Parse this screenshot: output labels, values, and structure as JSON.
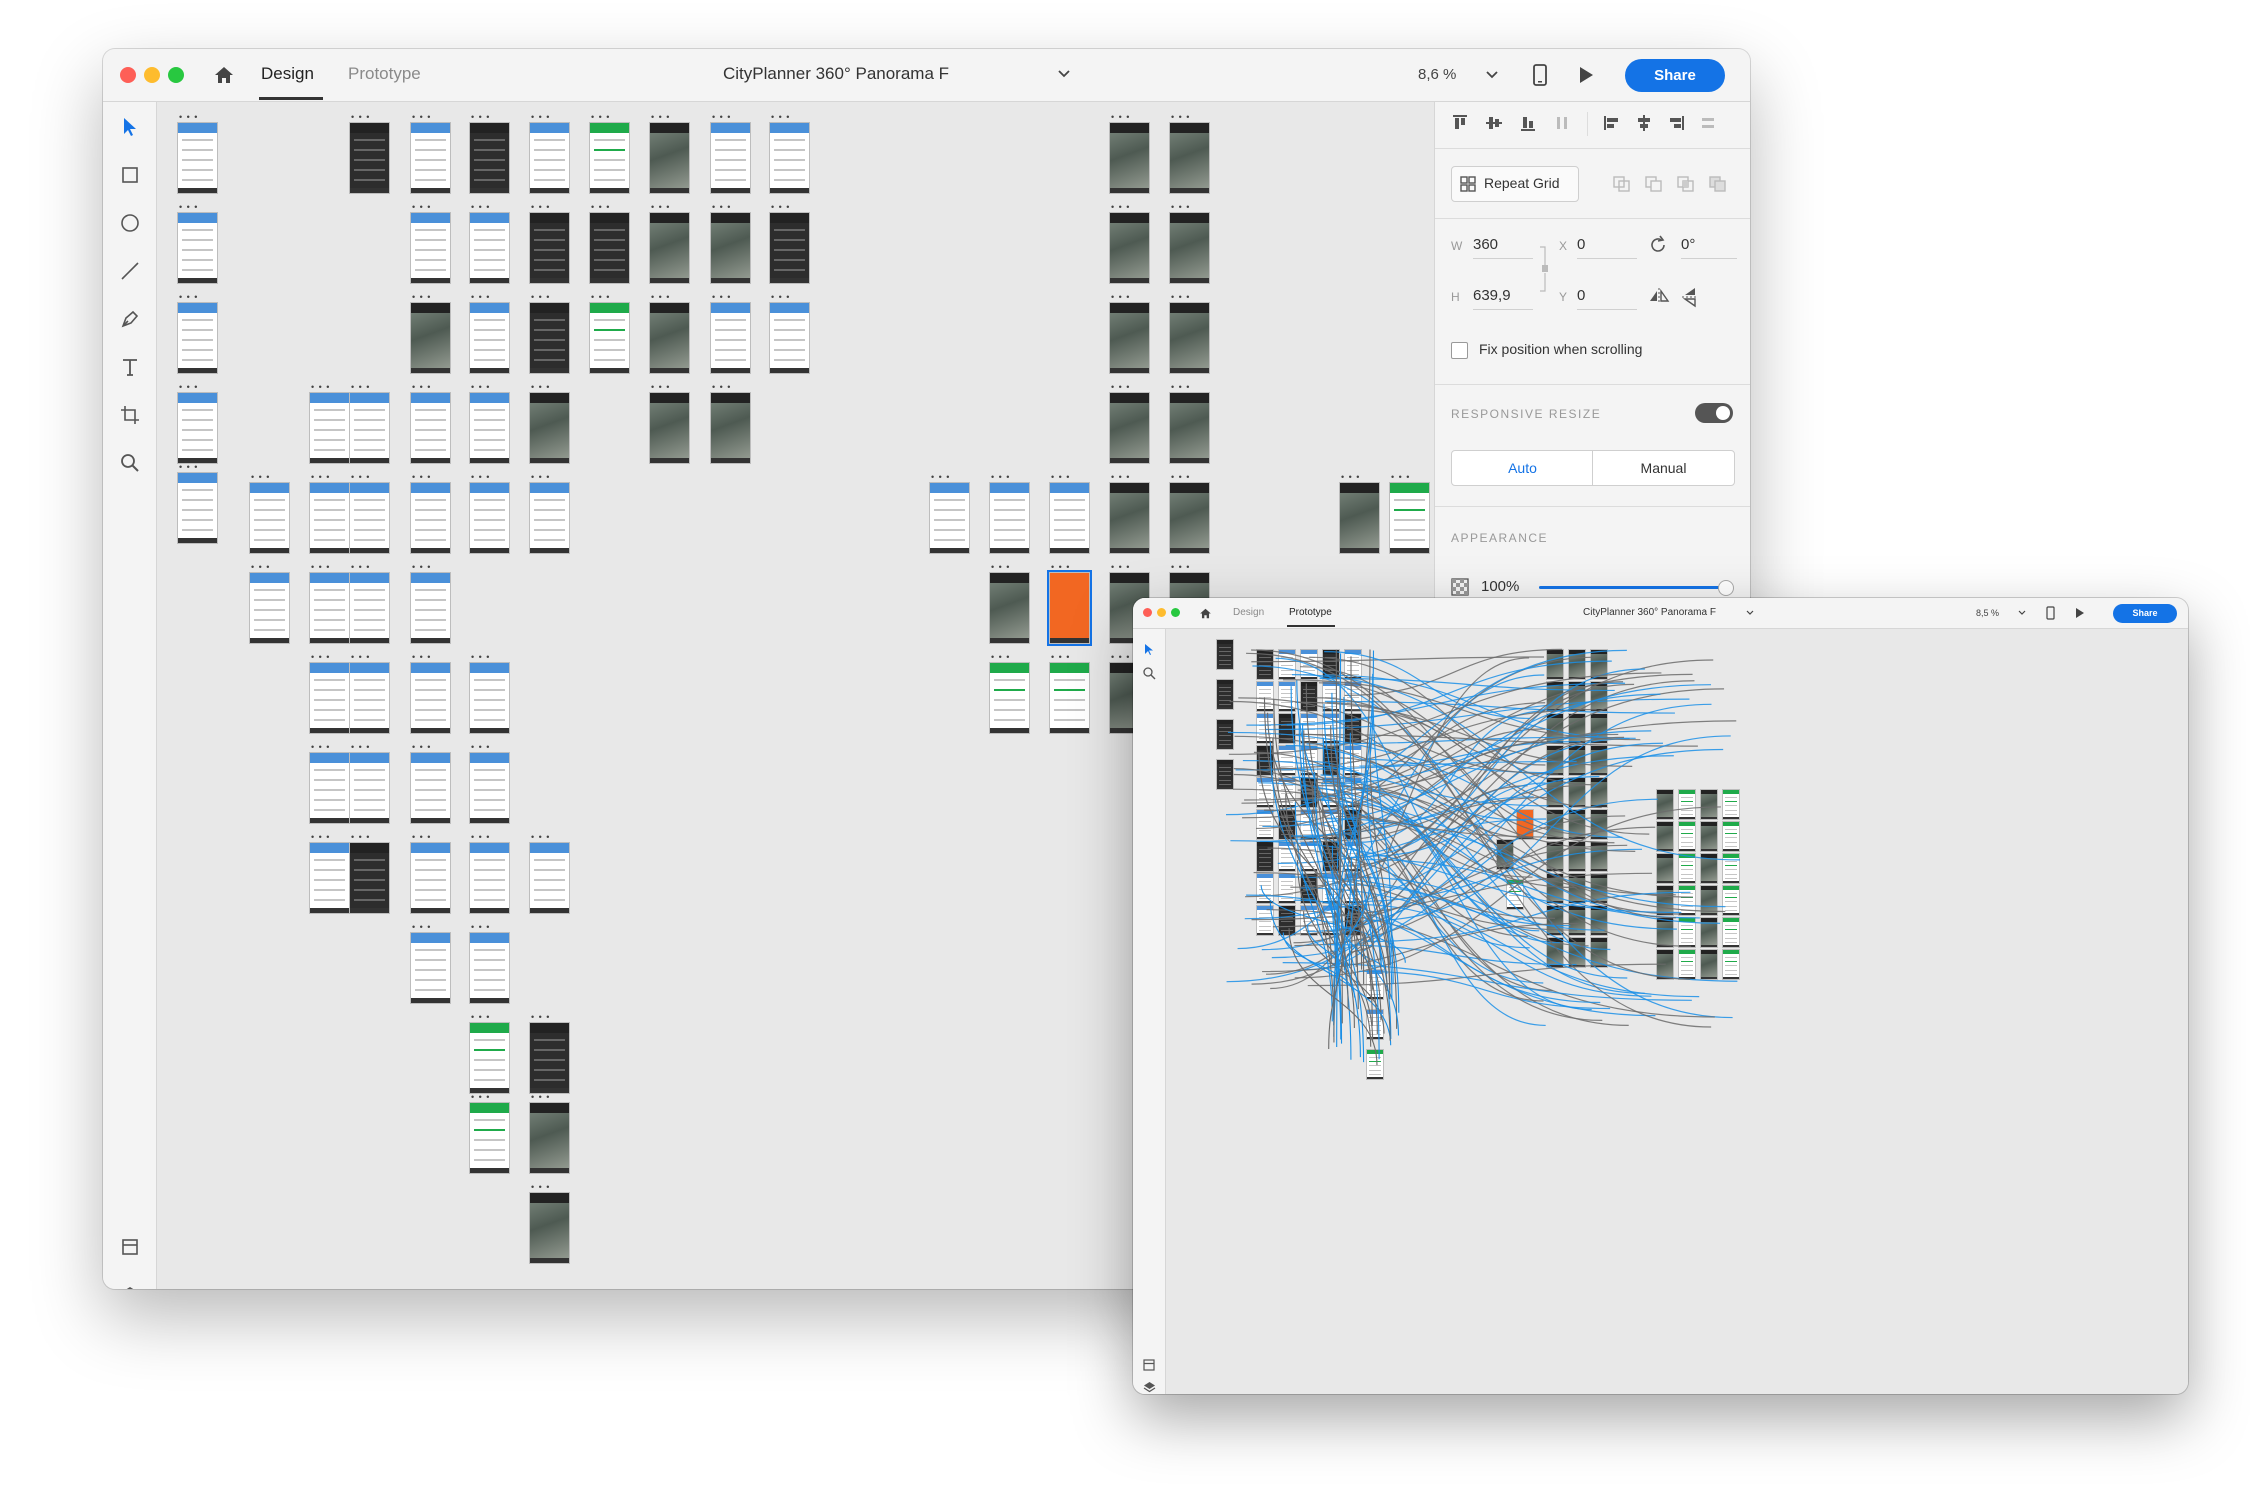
{
  "main": {
    "tabs": [
      {
        "label": "Design"
      },
      {
        "label": "Prototype"
      }
    ],
    "title": "CityPlanner 360° Panorama F",
    "zoom": "8,6 %",
    "share": "Share",
    "tools": [
      "select-icon",
      "rectangle-icon",
      "ellipse-icon",
      "line-icon",
      "pen-icon",
      "text-icon",
      "artboard-icon",
      "zoom-icon"
    ],
    "bottom_tools": [
      "assets-icon",
      "layers-icon"
    ],
    "inspector": {
      "repeat_grid": "Repeat Grid",
      "w_label": "W",
      "w": "360",
      "x_label": "X",
      "x": "0",
      "rotation": "0°",
      "h_label": "H",
      "h": "639,9",
      "y_label": "Y",
      "y": "0",
      "fix_position": "Fix position when scrolling",
      "fix_position_checked": false,
      "responsive_label": "RESPONSIVE RESIZE",
      "responsive_on": true,
      "resize_options": [
        "Auto",
        "Manual"
      ],
      "resize_selected": "Auto",
      "appearance_label": "APPEARANCE",
      "opacity": "100%",
      "opacity_value": 1.0
    }
  },
  "proto": {
    "tabs": [
      {
        "label": "Design"
      },
      {
        "label": "Prototype"
      }
    ],
    "active_tab": "Prototype",
    "title": "CityPlanner 360° Panorama F",
    "zoom": "8,5 %",
    "share": "Share"
  },
  "colors": {
    "accent": "#1473e6",
    "wire_blue": "#1b8fe6",
    "wire_gray": "#6b6b6b",
    "header_blue": "#4a90d9",
    "header_green": "#1faa4a",
    "header_dark": "#222222",
    "splash_orange": "#f26722"
  }
}
